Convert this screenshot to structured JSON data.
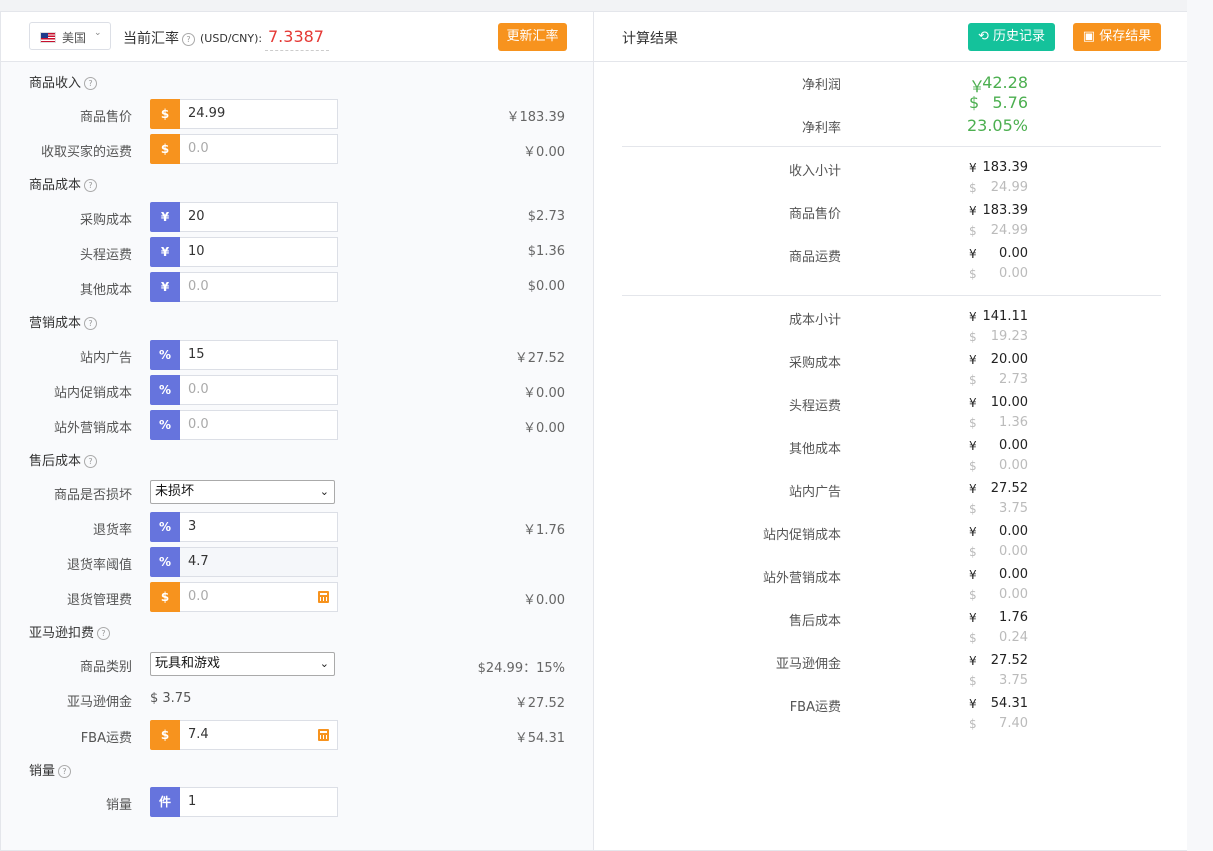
{
  "header": {
    "country": "美国",
    "rate_label": "当前汇率",
    "rate_unit": "(USD/CNY):",
    "rate_value": "7.3387",
    "update_button": "更新汇率"
  },
  "results_header": {
    "title": "计算结果",
    "history_button": "历史记录",
    "save_button": "保存结果"
  },
  "sections": {
    "income": "商品收入",
    "cost": "商品成本",
    "marketing": "营销成本",
    "aftersale": "售后成本",
    "amazon": "亚马逊扣费",
    "sales": "销量"
  },
  "rows": [
    {
      "label": "商品售价",
      "addon": "$",
      "value": "24.99",
      "conv": "￥183.39"
    },
    {
      "label": "收取买家的运费",
      "addon": "$",
      "value": "0.0",
      "conv": "￥0.00"
    },
    {
      "label": "采购成本",
      "addon": "¥",
      "value": "20",
      "conv": "$2.73"
    },
    {
      "label": "头程运费",
      "addon": "¥",
      "value": "10",
      "conv": "$1.36"
    },
    {
      "label": "其他成本",
      "addon": "¥",
      "value": "0.0",
      "conv": "$0.00"
    },
    {
      "label": "站内广告",
      "addon": "%",
      "value": "15",
      "conv": "￥27.52"
    },
    {
      "label": "站内促销成本",
      "addon": "%",
      "value": "0.0",
      "conv": "￥0.00"
    },
    {
      "label": "站外营销成本",
      "addon": "%",
      "value": "0.0",
      "conv": "￥0.00"
    },
    {
      "label": "商品是否损坏",
      "select": "未损坏"
    },
    {
      "label": "退货率",
      "addon": "%",
      "value": "3",
      "conv": "￥1.76"
    },
    {
      "label": "退货率阈值",
      "addon": "%",
      "value": "4.7"
    },
    {
      "label": "退货管理费",
      "addon": "$",
      "value": "0.0",
      "conv": "￥0.00"
    },
    {
      "label": "商品类别",
      "select": "玩具和游戏",
      "conv": "$24.99：15%"
    },
    {
      "label": "亚马逊佣金",
      "text": "$ 3.75",
      "conv": "￥27.52"
    },
    {
      "label": "FBA运费",
      "addon": "$",
      "value": "7.4",
      "conv": "￥54.31"
    },
    {
      "label": "销量",
      "addon": "件",
      "value": "1"
    }
  ],
  "results": {
    "net_profit_label": "净利润",
    "net_profit_cny_symbol": "￥",
    "net_profit_cny": "42.28",
    "net_profit_usd_symbol": "$",
    "net_profit_usd": "5.76",
    "net_margin_label": "净利率",
    "net_margin": "23.05%",
    "cny_symbol": "¥",
    "usd_symbol": "$",
    "items": [
      {
        "label": "收入小计",
        "cny": "183.39",
        "usd": "24.99"
      },
      {
        "label": "商品售价",
        "cny": "183.39",
        "usd": "24.99"
      },
      {
        "label": "商品运费",
        "cny": "0.00",
        "usd": "0.00"
      },
      {
        "label": "成本小计",
        "cny": "141.11",
        "usd": "19.23"
      },
      {
        "label": "采购成本",
        "cny": "20.00",
        "usd": "2.73"
      },
      {
        "label": "头程运费",
        "cny": "10.00",
        "usd": "1.36"
      },
      {
        "label": "其他成本",
        "cny": "0.00",
        "usd": "0.00"
      },
      {
        "label": "站内广告",
        "cny": "27.52",
        "usd": "3.75"
      },
      {
        "label": "站内促销成本",
        "cny": "0.00",
        "usd": "0.00"
      },
      {
        "label": "站外营销成本",
        "cny": "0.00",
        "usd": "0.00"
      },
      {
        "label": "售后成本",
        "cny": "1.76",
        "usd": "0.24"
      },
      {
        "label": "亚马逊佣金",
        "cny": "27.52",
        "usd": "3.75"
      },
      {
        "label": "FBA运费",
        "cny": "54.31",
        "usd": "7.40"
      }
    ]
  }
}
